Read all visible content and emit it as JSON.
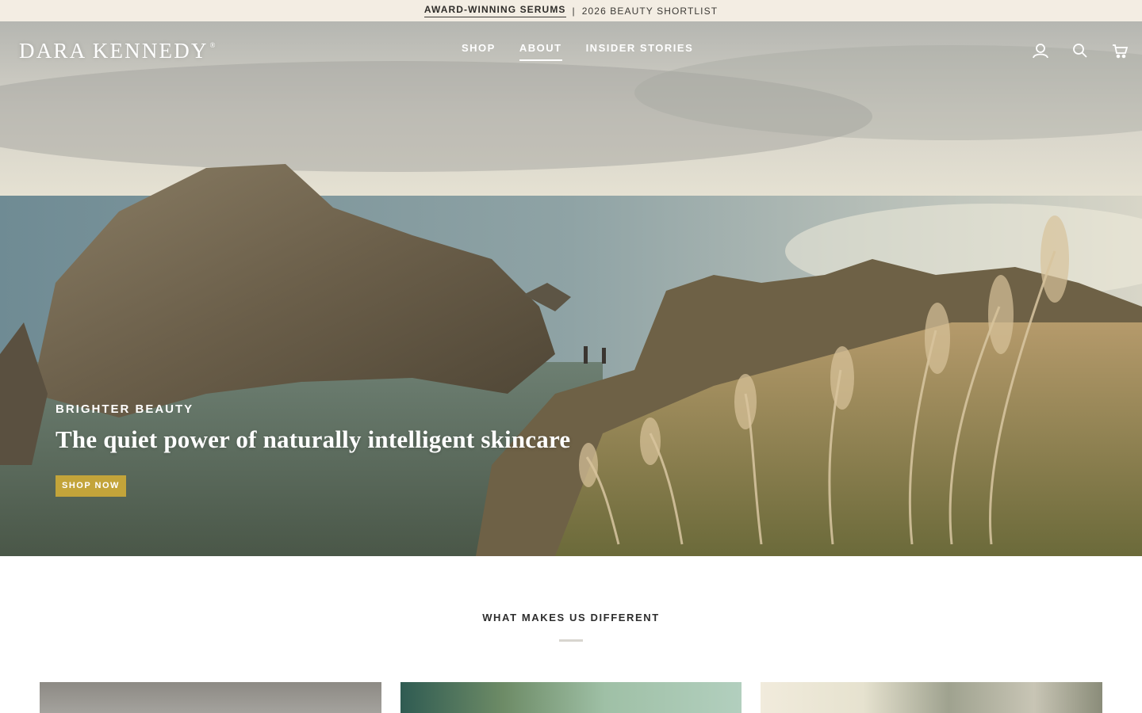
{
  "announcement": {
    "highlight": "AWARD-WINNING SERUMS",
    "separator": "|",
    "text": "2026 BEAUTY SHORTLIST"
  },
  "header": {
    "logo": "DARA KENNEDY",
    "logo_mark": "®",
    "nav": [
      {
        "label": "SHOP",
        "active": false
      },
      {
        "label": "ABOUT",
        "active": true
      },
      {
        "label": "INSIDER STORIES",
        "active": false
      }
    ],
    "icons": [
      "account-icon",
      "search-icon",
      "cart-icon"
    ]
  },
  "hero": {
    "eyebrow": "BRIGHTER BEAUTY",
    "headline": "The quiet power of naturally intelligent skincare",
    "cta_label": "SHOP NOW",
    "cta_color": "#c3a43a"
  },
  "section": {
    "title": "WHAT MAKES US DIFFERENT"
  }
}
